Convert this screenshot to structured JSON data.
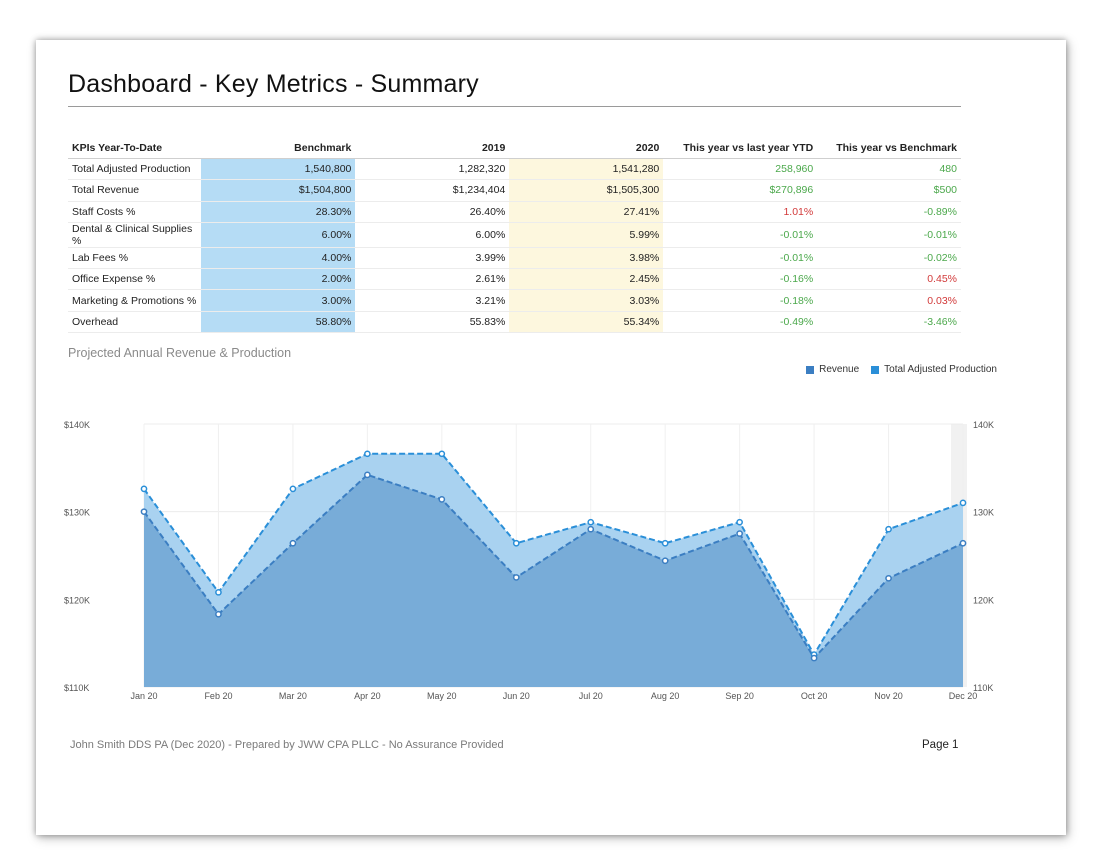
{
  "title": "Dashboard - Key Metrics - Summary",
  "table": {
    "headers": [
      "KPIs Year-To-Date",
      "Benchmark",
      "2019",
      "2020",
      "This year vs last year YTD",
      "This year vs Benchmark"
    ],
    "rows": [
      {
        "kpi": "Total Adjusted Production",
        "benchmark": "1,540,800",
        "y2019": "1,282,320",
        "y2020": "1,541,280",
        "vs_last": "258,960",
        "vs_last_status": "pos",
        "vs_bench": "480",
        "vs_bench_status": "pos"
      },
      {
        "kpi": "Total Revenue",
        "benchmark": "$1,504,800",
        "y2019": "$1,234,404",
        "y2020": "$1,505,300",
        "vs_last": "$270,896",
        "vs_last_status": "pos",
        "vs_bench": "$500",
        "vs_bench_status": "pos"
      },
      {
        "kpi": "Staff Costs %",
        "benchmark": "28.30%",
        "y2019": "26.40%",
        "y2020": "27.41%",
        "vs_last": "1.01%",
        "vs_last_status": "neg",
        "vs_bench": "-0.89%",
        "vs_bench_status": "pos"
      },
      {
        "kpi": "Dental & Clinical Supplies %",
        "benchmark": "6.00%",
        "y2019": "6.00%",
        "y2020": "5.99%",
        "vs_last": "-0.01%",
        "vs_last_status": "pos",
        "vs_bench": "-0.01%",
        "vs_bench_status": "pos"
      },
      {
        "kpi": "Lab Fees %",
        "benchmark": "4.00%",
        "y2019": "3.99%",
        "y2020": "3.98%",
        "vs_last": "-0.01%",
        "vs_last_status": "pos",
        "vs_bench": "-0.02%",
        "vs_bench_status": "pos"
      },
      {
        "kpi": "Office Expense %",
        "benchmark": "2.00%",
        "y2019": "2.61%",
        "y2020": "2.45%",
        "vs_last": "-0.16%",
        "vs_last_status": "pos",
        "vs_bench": "0.45%",
        "vs_bench_status": "neg"
      },
      {
        "kpi": "Marketing & Promotions %",
        "benchmark": "3.00%",
        "y2019": "3.21%",
        "y2020": "3.03%",
        "vs_last": "-0.18%",
        "vs_last_status": "pos",
        "vs_bench": "0.03%",
        "vs_bench_status": "neg"
      },
      {
        "kpi": "Overhead",
        "benchmark": "58.80%",
        "y2019": "55.83%",
        "y2020": "55.34%",
        "vs_last": "-0.49%",
        "vs_last_status": "pos",
        "vs_bench": "-3.46%",
        "vs_bench_status": "pos"
      }
    ]
  },
  "colors": {
    "benchmark_fill": "#b5dcf5",
    "y2020_fill": "#fdf7de",
    "positive": "#4ba84b",
    "negative": "#d23a3a",
    "revenue": "#3b7ec2",
    "production": "#2a8fd8"
  },
  "chart_data": {
    "type": "area",
    "title": "Projected Annual Revenue & Production",
    "categories": [
      "Jan 20",
      "Feb 20",
      "Mar 20",
      "Apr 20",
      "May 20",
      "Jun 20",
      "Jul 20",
      "Aug 20",
      "Sep 20",
      "Oct 20",
      "Nov 20",
      "Dec 20"
    ],
    "series": [
      {
        "name": "Revenue",
        "values": [
          130000,
          118300,
          126400,
          134200,
          131400,
          122500,
          128000,
          124400,
          127500,
          113300,
          122400,
          126400
        ]
      },
      {
        "name": "Total Adjusted Production",
        "values": [
          132600,
          120800,
          132600,
          136600,
          136600,
          126400,
          128800,
          126400,
          128800,
          113700,
          128000,
          131000
        ]
      }
    ],
    "ylim": [
      110000,
      140000
    ],
    "left_ticks": [
      "$140K",
      "$130K",
      "$120K",
      "$110K"
    ],
    "right_ticks": [
      "140K",
      "130K",
      "120K",
      "110K"
    ],
    "legend_position": "top-right",
    "grid": true
  },
  "footer": {
    "left": "John Smith DDS PA (Dec 2020) - Prepared by JWW CPA PLLC - No Assurance Provided",
    "right": "Page 1"
  }
}
